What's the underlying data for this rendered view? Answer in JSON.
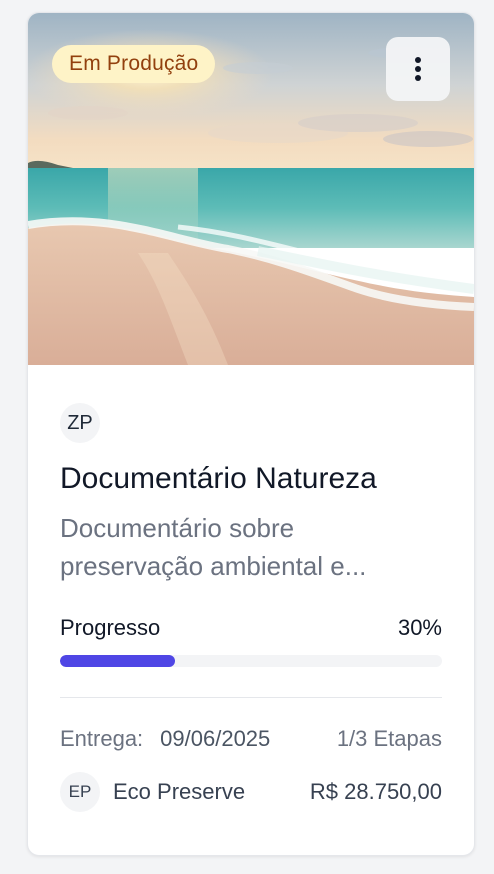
{
  "project": {
    "status": "Em Produção",
    "initials": "ZP",
    "title": "Documentário Natureza",
    "description": "Documentário sobre preservação ambiental e...",
    "progress_label": "Progresso",
    "progress_text": "30%",
    "progress_value": 30,
    "delivery_label": "Entrega:",
    "delivery_date": "09/06/2025",
    "stages": "1/3 Etapas",
    "client_initials": "EP",
    "client_name": "Eco Preserve",
    "price": "R$ 28.750,00"
  },
  "icons": {
    "menu": "more-vertical-icon"
  },
  "colors": {
    "status_bg": "#fef3c7",
    "status_text": "#92400e",
    "progress_fill": "#4f46e5",
    "progress_track": "#f3f4f6"
  }
}
